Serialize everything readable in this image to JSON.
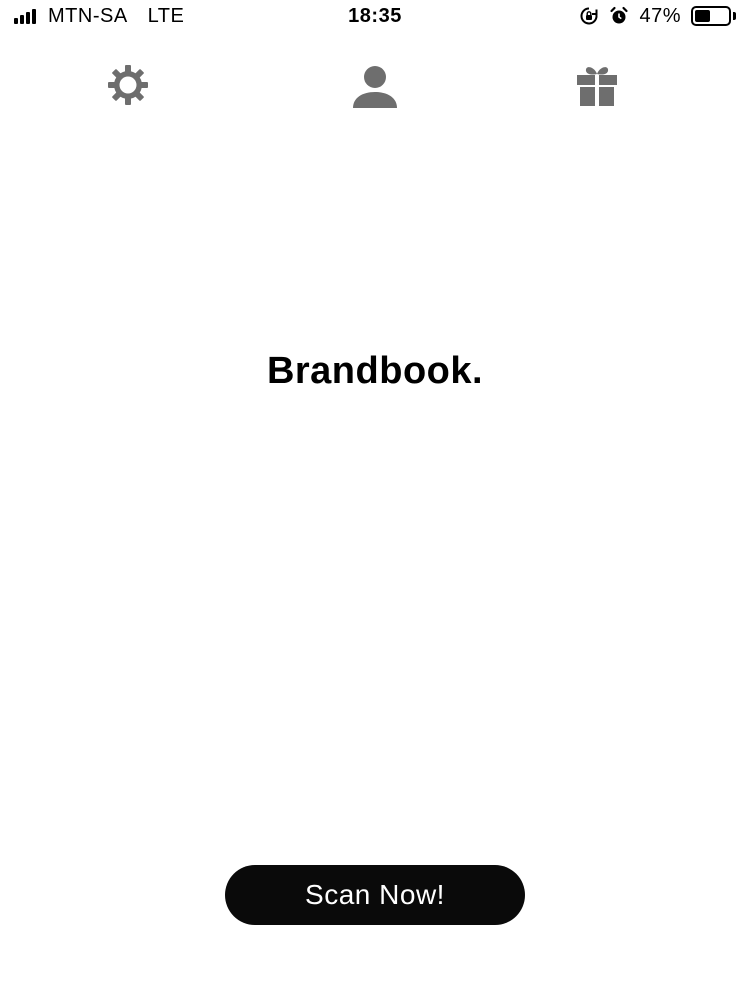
{
  "status_bar": {
    "carrier": "MTN-SA",
    "network": "LTE",
    "time": "18:35",
    "battery_percent": "47%",
    "battery_level": 0.47,
    "icons": [
      "signal-icon",
      "rotation-lock-icon",
      "alarm-icon",
      "battery-icon"
    ]
  },
  "nav": {
    "icons": [
      "gear-icon",
      "user-icon",
      "gift-icon"
    ],
    "icon_color": "#6e6e6e"
  },
  "main": {
    "logo_text": "Brandbook."
  },
  "actions": {
    "scan_label": "Scan Now!",
    "button_color": "#0a0a0a",
    "button_text_color": "#ffffff"
  }
}
